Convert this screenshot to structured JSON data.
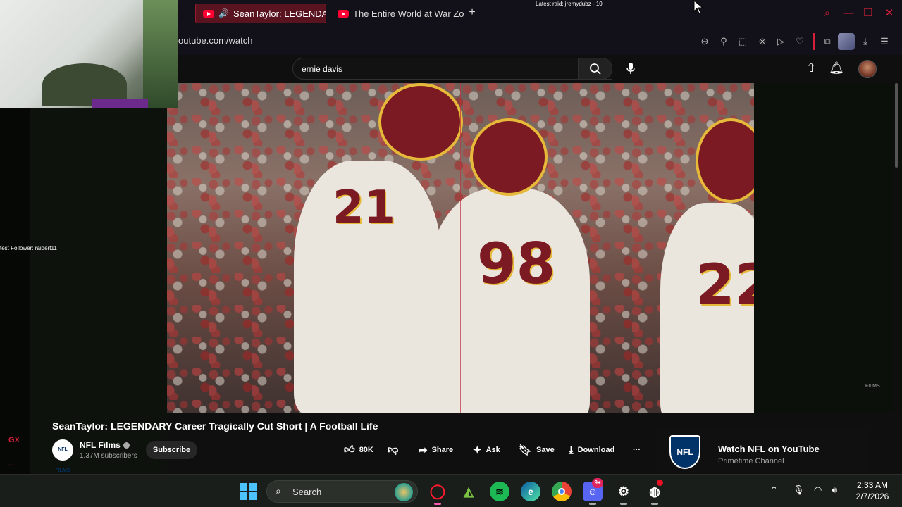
{
  "overlay": {
    "latest_raid": "Latest raid: jremydubz - 10",
    "latest_follower": "test Follower: raidert11",
    "gx_label": "GX",
    "gx_more": "..."
  },
  "browser": {
    "tabs": [
      {
        "label": "SeanTaylor: LEGENDA",
        "active": true
      },
      {
        "label": "The Entire World at War Zo",
        "active": false
      }
    ],
    "url": "outube.com/watch",
    "accent": "#d6203a"
  },
  "youtube": {
    "search_value": "ernie davis",
    "video": {
      "title": "SeanTaylor: LEGENDARY Career Tragically Cut Short | A Football Life",
      "watermark": "FILMS",
      "jersey_numbers": [
        "21",
        "98",
        "22"
      ]
    },
    "channel": {
      "name": "NFL Films",
      "subscribers": "1.37M subscribers",
      "logo_text": "NFL FILMS"
    },
    "subscribe_label": "Subscribe",
    "actions": {
      "likes": "80K",
      "share": "Share",
      "ask": "Ask",
      "save": "Save",
      "download": "Download",
      "more": "···"
    },
    "promo": {
      "logo_text": "NFL",
      "title": "Watch NFL on YouTube",
      "subtitle": "Primetime Channel"
    }
  },
  "taskbar": {
    "search_label": "Search",
    "time": "2:33 AM",
    "date": "2/7/2026",
    "discord_badge": "9+"
  }
}
